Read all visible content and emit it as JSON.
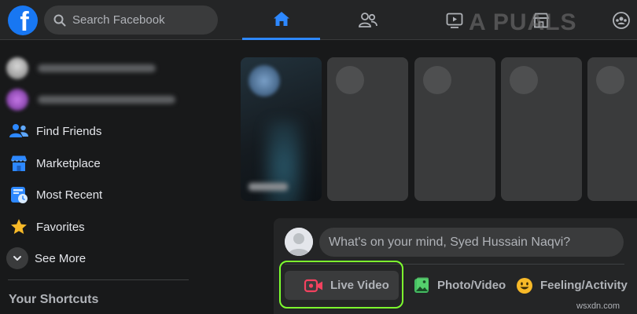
{
  "app": {
    "logo_letter": "f",
    "brand_color": "#1877f2"
  },
  "search": {
    "placeholder": "Search Facebook"
  },
  "nav": {
    "tabs": [
      {
        "name": "home",
        "icon": "home-icon",
        "active": true
      },
      {
        "name": "friends",
        "icon": "friends-icon",
        "active": false
      },
      {
        "name": "watch",
        "icon": "video-play-icon",
        "active": false
      },
      {
        "name": "marketplace",
        "icon": "store-icon",
        "active": false
      },
      {
        "name": "groups",
        "icon": "groups-icon",
        "active": false
      }
    ],
    "active_color": "#2d88ff"
  },
  "watermark": {
    "text": "A PUALS"
  },
  "sidebar": {
    "items": [
      {
        "label": "Find Friends",
        "icon": "friends-icon"
      },
      {
        "label": "Marketplace",
        "icon": "store-icon"
      },
      {
        "label": "Most Recent",
        "icon": "feed-clock-icon"
      },
      {
        "label": "Favorites",
        "icon": "star-icon"
      },
      {
        "label": "See More",
        "icon": "chevron-down-icon"
      }
    ],
    "section_title": "Your Shortcuts"
  },
  "composer": {
    "placeholder": "What's on your mind, Syed Hussain Naqvi?",
    "buttons": [
      {
        "label": "Live Video",
        "icon": "live-video-icon",
        "color": "#f3425f",
        "highlighted": true
      },
      {
        "label": "Photo/Video",
        "icon": "photo-icon",
        "color": "#45bd62"
      },
      {
        "label": "Feeling/Activity",
        "icon": "smiley-icon",
        "color": "#f7b928"
      }
    ],
    "highlight_color": "#7dff2e"
  },
  "footer": {
    "site": "wsxdn.com"
  }
}
